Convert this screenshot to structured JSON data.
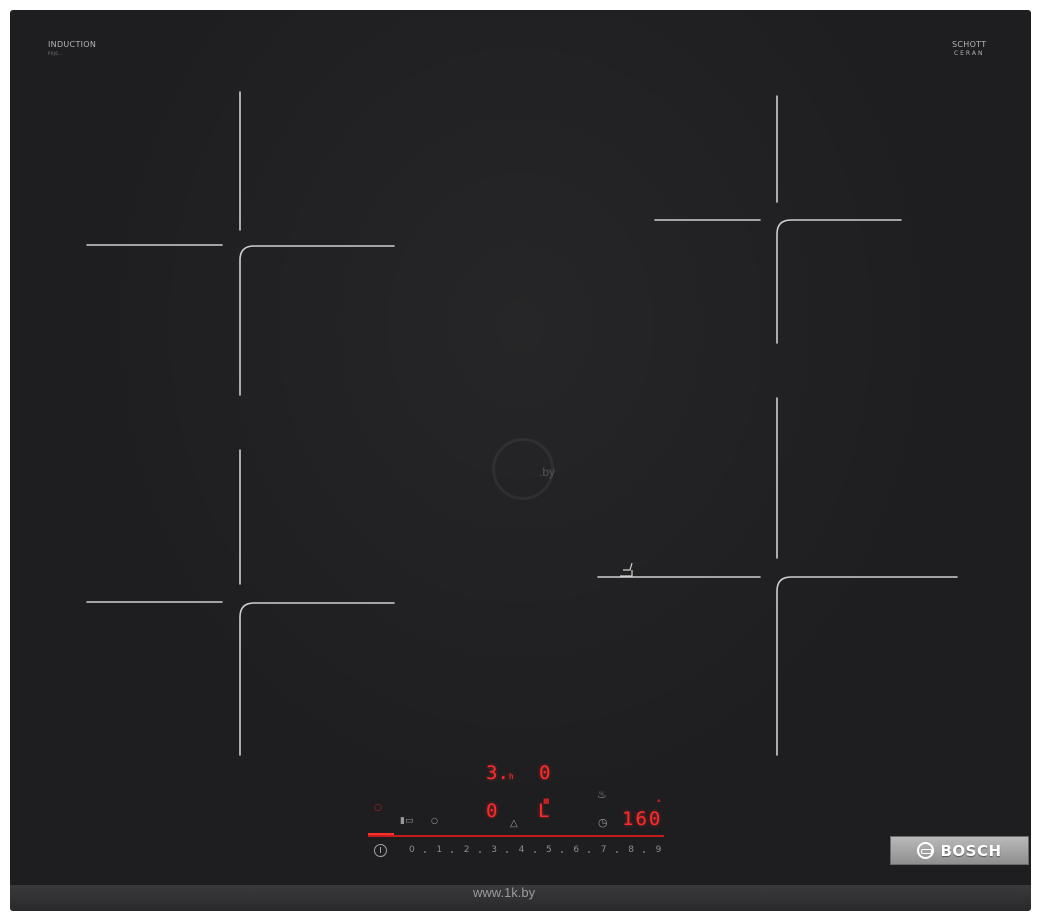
{
  "brand_top_left": {
    "title": "INDUCTION",
    "sub": "PXJ6..."
  },
  "brand_top_right": {
    "line1": "SCHOTT",
    "line2": "CERAN"
  },
  "watermark_center": ".by",
  "watermark_bottom": "www.1k.by",
  "display": {
    "timer_top": "3.",
    "timer_top_sub": "h",
    "level_top": "0",
    "level_mid": "0",
    "mode_mid": "L",
    "temperature": "160"
  },
  "slider_labels": [
    "0",
    "1",
    "2",
    "3",
    "4",
    "5",
    "6",
    "7",
    "8",
    "9"
  ],
  "brand_plate": "BOSCH",
  "colors": {
    "glass": "#1e1e20",
    "display_red": "#ff2a2a",
    "zone_lines": "#cfcfcf"
  }
}
